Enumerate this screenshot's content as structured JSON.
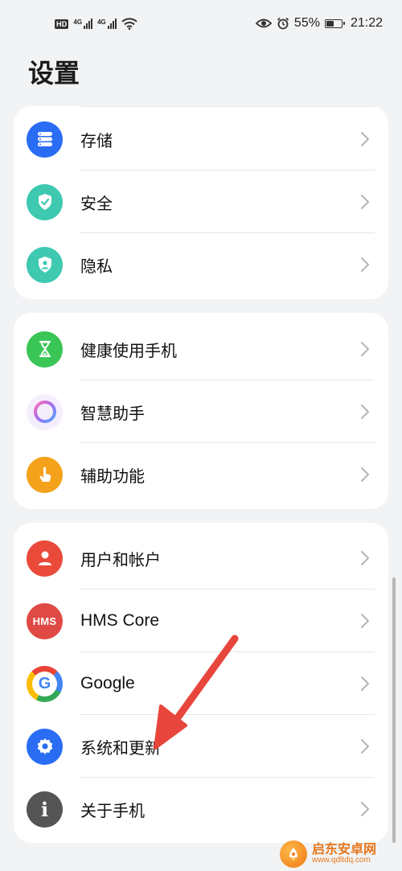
{
  "status_bar": {
    "hd_badge": "HD",
    "sim1_tag": "4G",
    "sim2_tag": "4G",
    "battery_percent": "55%",
    "battery_level": 0.55,
    "time": "21:22"
  },
  "page": {
    "title": "设置"
  },
  "groups": [
    {
      "items": [
        {
          "label": "存储",
          "icon": "storage-icon",
          "color": "#2a6df4"
        },
        {
          "label": "安全",
          "icon": "shield-check-icon",
          "color": "#3ec9b0"
        },
        {
          "label": "隐私",
          "icon": "privacy-icon",
          "color": "#3ec9b0"
        }
      ]
    },
    {
      "items": [
        {
          "label": "健康使用手机",
          "icon": "hourglass-icon",
          "color": "#3ac557"
        },
        {
          "label": "智慧助手",
          "icon": "assistant-ring-icon",
          "color": "#b47bf0"
        },
        {
          "label": "辅助功能",
          "icon": "hand-tap-icon",
          "color": "#f5a21b"
        }
      ]
    },
    {
      "items": [
        {
          "label": "用户和帐户",
          "icon": "user-icon",
          "color": "#ea4a3a"
        },
        {
          "label": "HMS Core",
          "icon": "hms-core-icon",
          "icon_text": "HMS",
          "color": "#e04a44"
        },
        {
          "label": "Google",
          "icon": "google-icon",
          "icon_text": "G",
          "color": "#4285f4"
        },
        {
          "label": "系统和更新",
          "icon": "gear-icon",
          "color": "#2a6df4"
        },
        {
          "label": "关于手机",
          "icon": "info-icon",
          "icon_text": "i",
          "color": "#555555"
        }
      ]
    }
  ],
  "watermark": {
    "name": "启东安卓网",
    "url": "www.qdltdq.com"
  }
}
